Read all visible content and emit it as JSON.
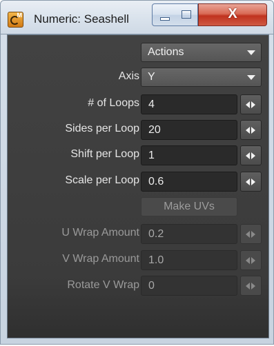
{
  "window": {
    "title": "Numeric: Seashell",
    "app_icon": "lightwave-modeler-icon",
    "buttons": {
      "minimize": "minimize-icon",
      "maximize": "maximize-icon",
      "close": "close-icon",
      "close_glyph": "X"
    }
  },
  "actions": {
    "label": "Actions"
  },
  "axis": {
    "label": "Axis",
    "value": "Y"
  },
  "fields": {
    "loops": {
      "label": "# of Loops",
      "value": "4"
    },
    "sides": {
      "label": "Sides per Loop",
      "value": "20"
    },
    "shift": {
      "label": "Shift per Loop",
      "value": "1"
    },
    "scale": {
      "label": "Scale per Loop",
      "value": "0.6"
    },
    "make_uvs": {
      "label": "Make UVs"
    },
    "u_wrap": {
      "label": "U Wrap Amount",
      "value": "0.2"
    },
    "v_wrap": {
      "label": "V Wrap Amount",
      "value": "1.0"
    },
    "rotate_v": {
      "label": "Rotate V Wrap",
      "value": "0"
    }
  },
  "colors": {
    "panel": "#3e3e3e",
    "field": "#2a2a2a",
    "label": "#e6e6e6",
    "disabled": "#9a9a9a",
    "close": "#c0321e"
  }
}
